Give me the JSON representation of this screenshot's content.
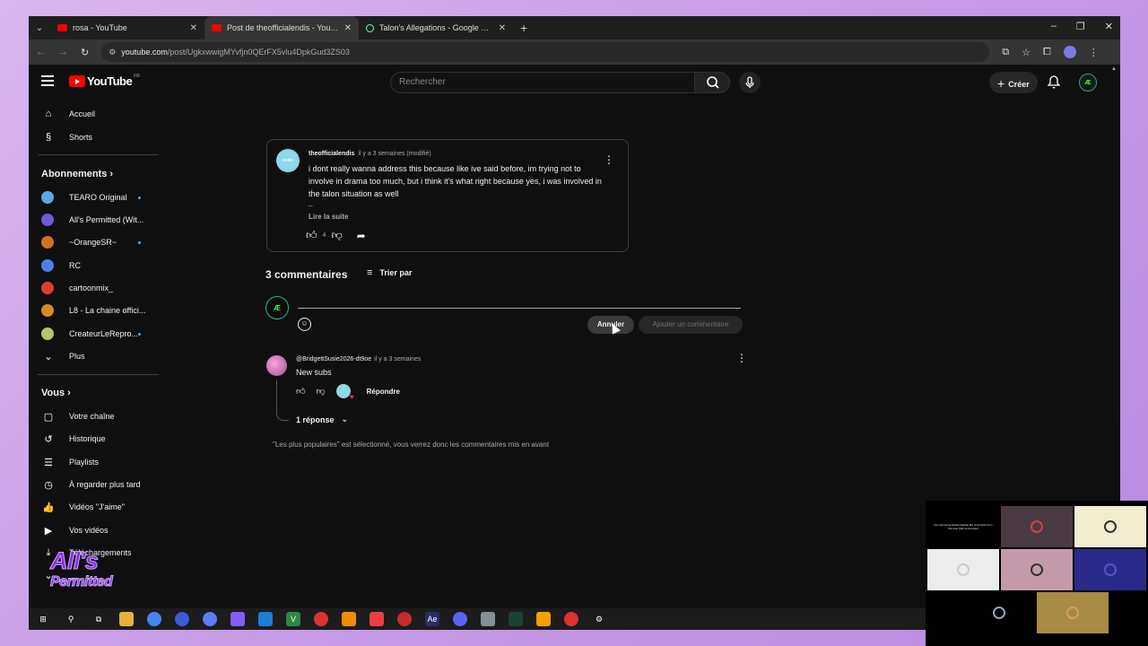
{
  "browser": {
    "tabs": [
      {
        "title": "rosa - YouTube"
      },
      {
        "title": "Post de theofficialendis - YouTube"
      },
      {
        "title": "Talon's Allegations - Google Docs"
      }
    ],
    "url_host": "youtube.com",
    "url_path": "/post/UgkxwwigMYvfjn0QErFX5vlu4DpkGud3ZS03"
  },
  "masthead": {
    "logo_text": "YouTube",
    "region": "FR",
    "search_placeholder": "Rechercher",
    "create_label": "Créer",
    "avatar_initials": "Æ"
  },
  "sidebar": {
    "main": [
      {
        "label": "Accueil",
        "icon": "home-icon"
      },
      {
        "label": "Shorts",
        "icon": "shorts-icon"
      }
    ],
    "subscriptions_heading": "Abonnements",
    "subscriptions": [
      {
        "label": "TEARO Original",
        "color": "#5aa9e6",
        "live": true
      },
      {
        "label": "All's Permitted (Wit...",
        "color": "#6f5bd4",
        "live": false
      },
      {
        "label": "~OrangeSR~",
        "color": "#d6701e",
        "live": true
      },
      {
        "label": "RC",
        "color": "#4d7ef0",
        "live": false
      },
      {
        "label": "cartoonmix_",
        "color": "#e03c3c",
        "live": false
      },
      {
        "label": "L8 - La chaine offici...",
        "color": "#d78a1e",
        "live": false
      },
      {
        "label": "CreateurLeRepro...",
        "color": "#b5c46b",
        "live": true
      },
      {
        "label": "Plus",
        "color": "",
        "live": false
      }
    ],
    "you_heading": "Vous",
    "you": [
      {
        "label": "Votre chaîne",
        "icon": "channel-icon"
      },
      {
        "label": "Historique",
        "icon": "history-icon"
      },
      {
        "label": "Playlists",
        "icon": "playlists-icon"
      },
      {
        "label": "À regarder plus tard",
        "icon": "watch-later-icon"
      },
      {
        "label": "Vidéos \"J'aime\"",
        "icon": "liked-icon"
      },
      {
        "label": "Vos vidéos",
        "icon": "your-videos-icon"
      },
      {
        "label": "Téléchargements",
        "icon": "downloads-icon"
      }
    ],
    "overlay_logo_line1": "All's",
    "overlay_logo_line2": "Permitted"
  },
  "post": {
    "avatar_text": "endis",
    "author": "theofficialendis",
    "meta": "il y a 3 semaines (modifié)",
    "body": "i dont really wanna address this because like ive said before, im trying not to involve in drama too much, but i think it's what right because yes, i was involved in the talon situation as well",
    "ellipsis": "_",
    "read_more": "Lire la suite",
    "likes": "4"
  },
  "comments": {
    "count_label": "3 commentaires",
    "sort_label": "Trier par",
    "cancel_label": "Annuler",
    "add_label": "Ajouter un commentaire",
    "items": [
      {
        "author": "@BridgettSusie2026-dt9oe",
        "meta": "il y a 3 semaines",
        "text": "New subs",
        "reply_label": "Répondre",
        "replies_label": "1 réponse"
      }
    ],
    "note": "\"Les plus populaires\" est sélectionné, vous verrez donc les commentaires mis en avant"
  },
  "call": {
    "tile_text": "the comments shown display the comments from the user that commented"
  }
}
